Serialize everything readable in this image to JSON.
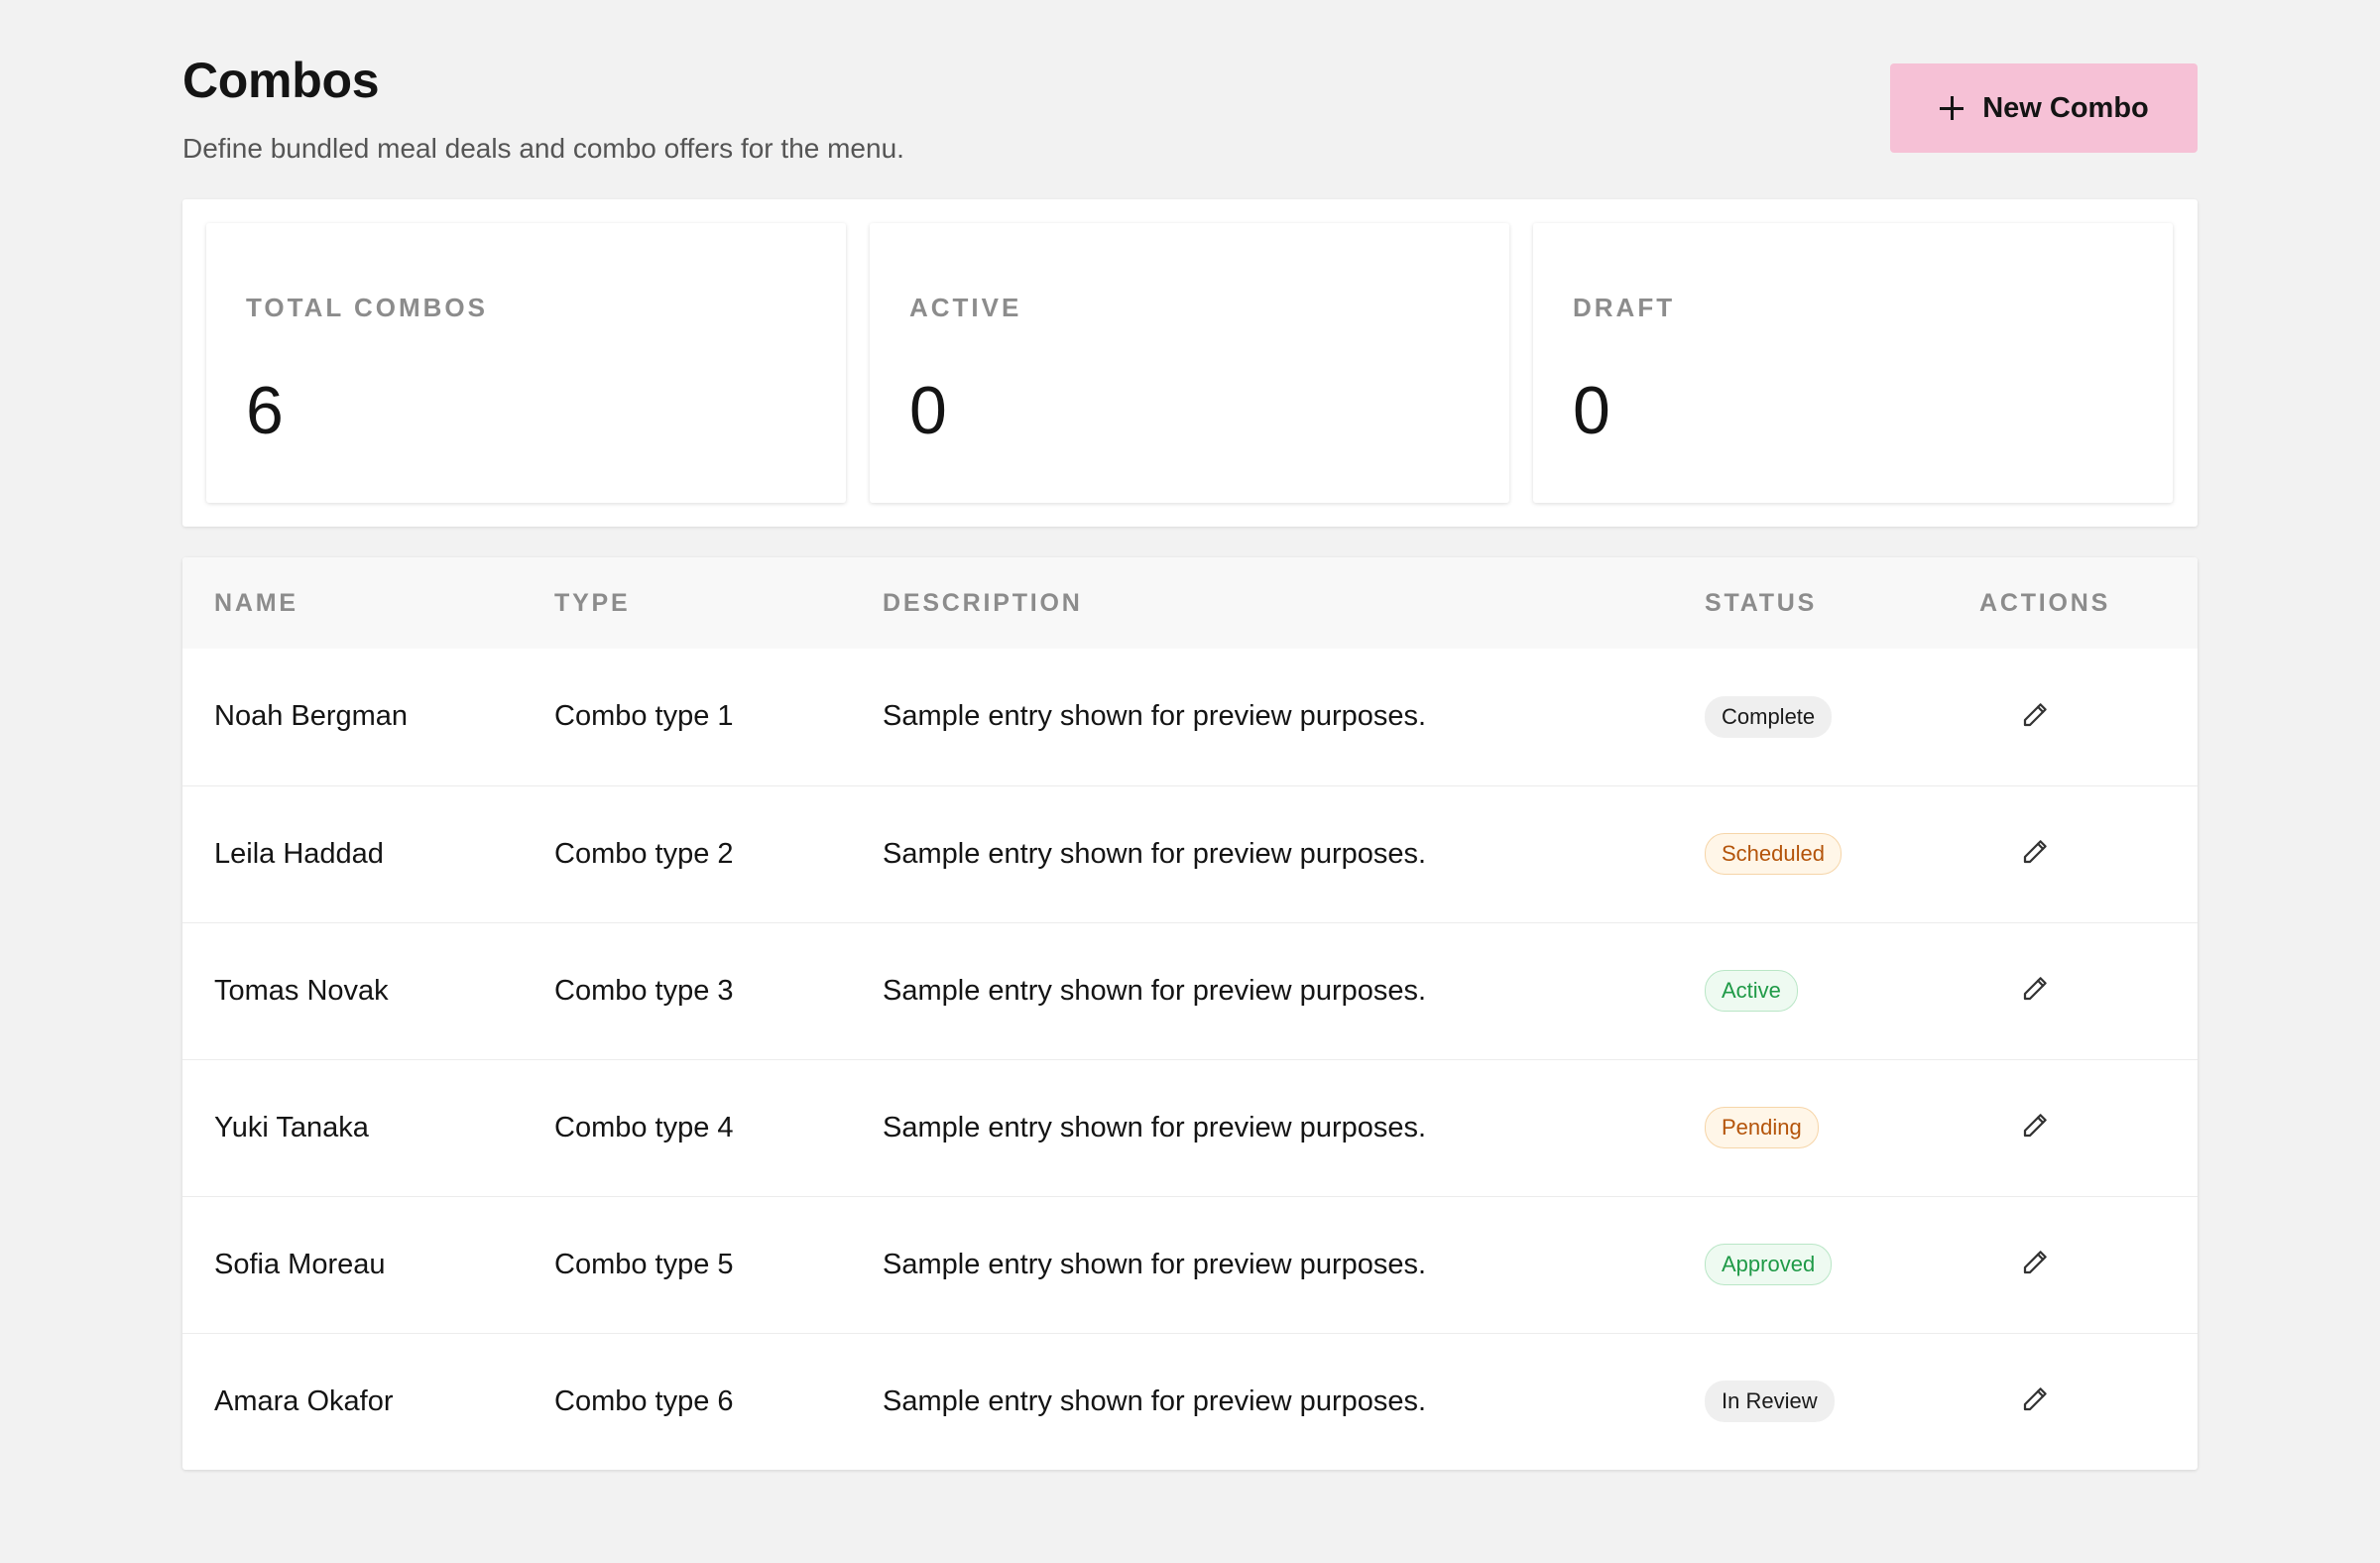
{
  "header": {
    "title": "Combos",
    "subtitle": "Define bundled meal deals and combo offers for the menu.",
    "new_button_label": "New Combo",
    "new_button_icon": "plus-icon",
    "accent_color": "#f6c1d6"
  },
  "stats": [
    {
      "label": "TOTAL COMBOS",
      "value": "6"
    },
    {
      "label": "ACTIVE",
      "value": "0"
    },
    {
      "label": "DRAFT",
      "value": "0"
    }
  ],
  "table": {
    "columns": [
      "NAME",
      "TYPE",
      "DESCRIPTION",
      "STATUS",
      "ACTIONS"
    ],
    "row_action_icon": "pencil-icon",
    "rows": [
      {
        "name": "Noah Bergman",
        "type": "Combo type 1",
        "description": "Sample entry shown for preview purposes.",
        "status": "Complete",
        "status_tone": "neutral"
      },
      {
        "name": "Leila Haddad",
        "type": "Combo type 2",
        "description": "Sample entry shown for preview purposes.",
        "status": "Scheduled",
        "status_tone": "warning"
      },
      {
        "name": "Tomas Novak",
        "type": "Combo type 3",
        "description": "Sample entry shown for preview purposes.",
        "status": "Active",
        "status_tone": "success"
      },
      {
        "name": "Yuki Tanaka",
        "type": "Combo type 4",
        "description": "Sample entry shown for preview purposes.",
        "status": "Pending",
        "status_tone": "warning"
      },
      {
        "name": "Sofia Moreau",
        "type": "Combo type 5",
        "description": "Sample entry shown for preview purposes.",
        "status": "Approved",
        "status_tone": "success"
      },
      {
        "name": "Amara Okafor",
        "type": "Combo type 6",
        "description": "Sample entry shown for preview purposes.",
        "status": "In Review",
        "status_tone": "neutral"
      }
    ]
  }
}
